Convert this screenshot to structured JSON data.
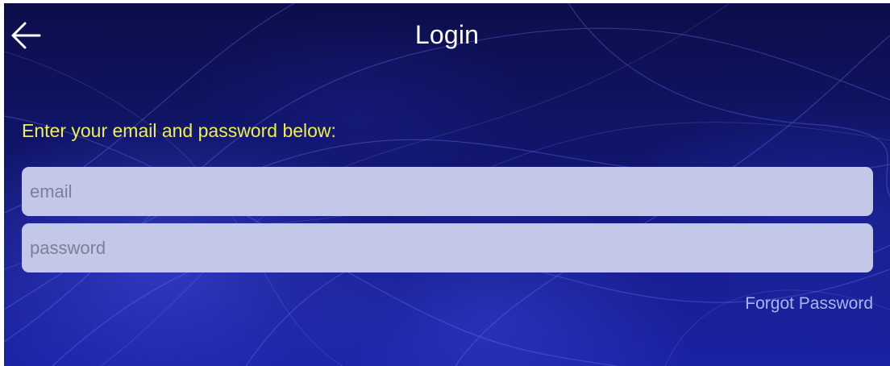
{
  "header": {
    "back_icon": "arrow-left-icon",
    "title": "Login"
  },
  "form": {
    "prompt": "Enter your email and password below:",
    "email": {
      "value": "",
      "placeholder": "email"
    },
    "password": {
      "value": "",
      "placeholder": "password"
    },
    "forgot_label": "Forgot Password"
  },
  "colors": {
    "background_dark": "#0c0e4a",
    "background_light": "#1b22a4",
    "title_text": "#ffffff",
    "prompt_text": "#eef04b",
    "field_fill": "#c4c8e8",
    "placeholder_text": "#7c7f96",
    "link_text": "#a9b6f5"
  }
}
